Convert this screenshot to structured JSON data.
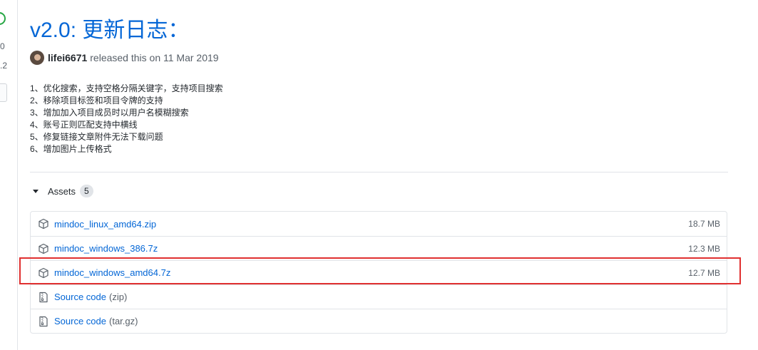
{
  "left_rail": {
    "num1": "0",
    "num2": ".2"
  },
  "release": {
    "title": "v2.0: 更新日志：",
    "author": "lifei6671",
    "released_text": "released this on 11 Mar 2019"
  },
  "notes": [
    "1、优化搜索，支持空格分隔关键字，支持项目搜索",
    "2、移除项目标签和项目令牌的支持",
    "3、增加加入项目成员时以用户名模糊搜索",
    "4、账号正则匹配支持中横线",
    "5、修复链接文章附件无法下载问题",
    "6、增加图片上传格式"
  ],
  "assets": {
    "title": "Assets",
    "count": "5",
    "files": [
      {
        "name": "mindoc_linux_amd64.zip",
        "size": "18.7 MB"
      },
      {
        "name": "mindoc_windows_386.7z",
        "size": "12.3 MB"
      },
      {
        "name": "mindoc_windows_amd64.7z",
        "size": "12.7 MB"
      }
    ],
    "source": [
      {
        "label": "Source code",
        "suffix": "(zip)"
      },
      {
        "label": "Source code",
        "suffix": "(tar.gz)"
      }
    ]
  },
  "colors": {
    "link": "#0366d6",
    "highlight": "#e03030",
    "border": "#e1e4e8"
  }
}
